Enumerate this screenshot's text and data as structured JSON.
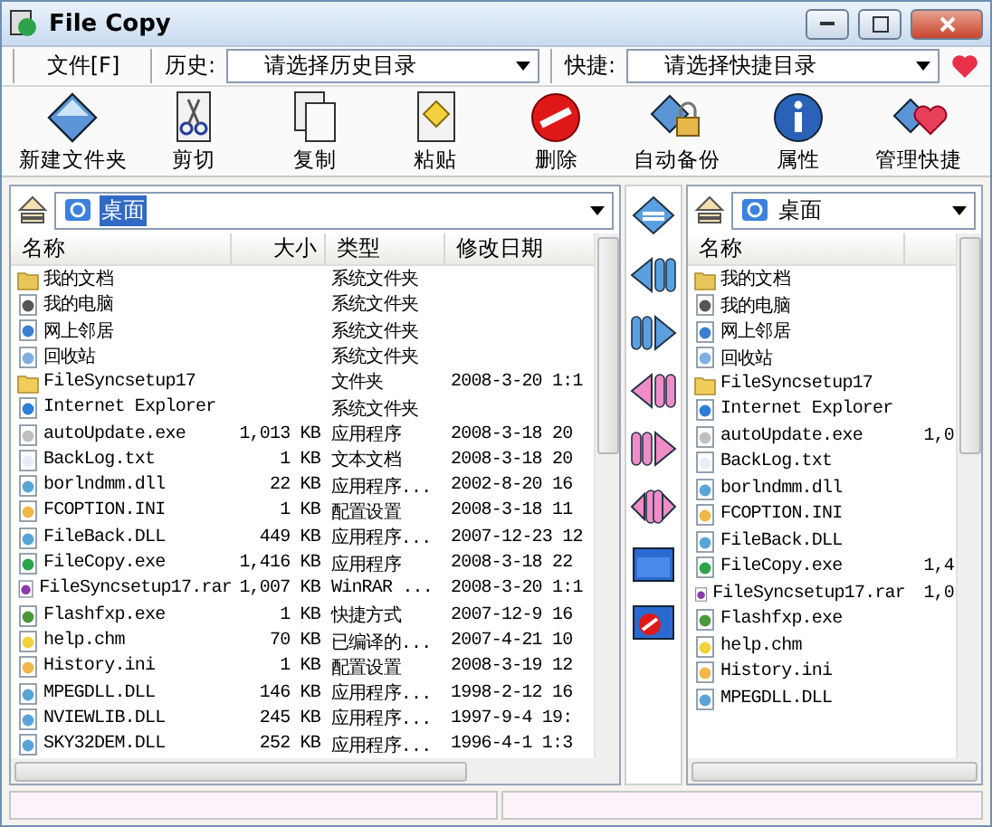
{
  "window": {
    "title": "File Copy"
  },
  "menu": {
    "file": "文件[F]",
    "history_label": "历史:",
    "history_placeholder": "请选择历史目录",
    "shortcut_label": "快捷:",
    "shortcut_placeholder": "请选择快捷目录"
  },
  "toolbar": [
    {
      "label": "新建文件夹",
      "kind": "newfolder"
    },
    {
      "label": "剪切",
      "kind": "cut"
    },
    {
      "label": "复制",
      "kind": "copy"
    },
    {
      "label": "粘贴",
      "kind": "paste"
    },
    {
      "label": "删除",
      "kind": "delete"
    },
    {
      "label": "自动备份",
      "kind": "backup"
    },
    {
      "label": "属性",
      "kind": "info"
    },
    {
      "label": "管理快捷",
      "kind": "favorite"
    }
  ],
  "left_panel": {
    "path": "桌面",
    "path_selected": true,
    "columns": [
      "名称",
      "大小",
      "类型",
      "修改日期"
    ],
    "rows": [
      {
        "name": "我的文档",
        "size": "",
        "type": "系统文件夹",
        "date": "",
        "kind": "docs"
      },
      {
        "name": "我的电脑",
        "size": "",
        "type": "系统文件夹",
        "date": "",
        "kind": "computer"
      },
      {
        "name": "网上邻居",
        "size": "",
        "type": "系统文件夹",
        "date": "",
        "kind": "network"
      },
      {
        "name": "回收站",
        "size": "",
        "type": "系统文件夹",
        "date": "",
        "kind": "recycle"
      },
      {
        "name": "FileSyncsetup17",
        "size": "",
        "type": "文件夹",
        "date": "2008-3-20 1:1",
        "kind": "folder"
      },
      {
        "name": "Internet Explorer",
        "size": "",
        "type": "系统文件夹",
        "date": "",
        "kind": "ie"
      },
      {
        "name": "autoUpdate.exe",
        "size": "1,013 KB",
        "type": "应用程序",
        "date": "2008-3-18 20",
        "kind": "exe"
      },
      {
        "name": "BackLog.txt",
        "size": "1 KB",
        "type": "文本文档",
        "date": "2008-3-18 20",
        "kind": "txt"
      },
      {
        "name": "borlndmm.dll",
        "size": "22 KB",
        "type": "应用程序...",
        "date": "2002-8-20 16",
        "kind": "dll"
      },
      {
        "name": "FCOPTION.INI",
        "size": "1 KB",
        "type": "配置设置",
        "date": "2008-3-18 11",
        "kind": "ini"
      },
      {
        "name": "FileBack.DLL",
        "size": "449 KB",
        "type": "应用程序...",
        "date": "2007-12-23 12",
        "kind": "dll"
      },
      {
        "name": "FileCopy.exe",
        "size": "1,416 KB",
        "type": "应用程序",
        "date": "2008-3-18 22",
        "kind": "app"
      },
      {
        "name": "FileSyncsetup17.rar",
        "size": "1,007 KB",
        "type": "WinRAR ...",
        "date": "2008-3-20 1:1",
        "kind": "rar"
      },
      {
        "name": "Flashfxp.exe",
        "size": "1 KB",
        "type": "快捷方式",
        "date": "2007-12-9 16",
        "kind": "shortcut"
      },
      {
        "name": "help.chm",
        "size": "70 KB",
        "type": "已编译的...",
        "date": "2007-4-21 10",
        "kind": "help"
      },
      {
        "name": "History.ini",
        "size": "1 KB",
        "type": "配置设置",
        "date": "2008-3-19 12",
        "kind": "ini"
      },
      {
        "name": "MPEGDLL.DLL",
        "size": "146 KB",
        "type": "应用程序...",
        "date": "1998-2-12 16",
        "kind": "dll"
      },
      {
        "name": "NVIEWLIB.DLL",
        "size": "245 KB",
        "type": "应用程序...",
        "date": "1997-9-4 19:",
        "kind": "dll"
      },
      {
        "name": "SKY32DEM.DLL",
        "size": "252 KB",
        "type": "应用程序...",
        "date": "1996-4-1 1:3",
        "kind": "dll"
      }
    ]
  },
  "right_panel": {
    "path": "桌面",
    "path_selected": false,
    "columns": [
      "名称"
    ],
    "rows": [
      {
        "name": "我的文档",
        "size": "",
        "kind": "docs"
      },
      {
        "name": "我的电脑",
        "size": "",
        "kind": "computer"
      },
      {
        "name": "网上邻居",
        "size": "",
        "kind": "network"
      },
      {
        "name": "回收站",
        "size": "",
        "kind": "recycle"
      },
      {
        "name": "FileSyncsetup17",
        "size": "",
        "kind": "folder"
      },
      {
        "name": "Internet Explorer",
        "size": "",
        "kind": "ie"
      },
      {
        "name": "autoUpdate.exe",
        "size": "1,0",
        "kind": "exe"
      },
      {
        "name": "BackLog.txt",
        "size": "",
        "kind": "txt"
      },
      {
        "name": "borlndmm.dll",
        "size": "",
        "kind": "dll"
      },
      {
        "name": "FCOPTION.INI",
        "size": "",
        "kind": "ini"
      },
      {
        "name": "FileBack.DLL",
        "size": "",
        "kind": "dll"
      },
      {
        "name": "FileCopy.exe",
        "size": "1,4",
        "kind": "app"
      },
      {
        "name": "FileSyncsetup17.rar",
        "size": "1,0",
        "kind": "rar"
      },
      {
        "name": "Flashfxp.exe",
        "size": "",
        "kind": "shortcut"
      },
      {
        "name": "help.chm",
        "size": "",
        "kind": "help"
      },
      {
        "name": "History.ini",
        "size": "",
        "kind": "ini"
      },
      {
        "name": "MPEGDLL.DLL",
        "size": "",
        "kind": "dll"
      }
    ]
  },
  "middle_buttons": [
    {
      "kind": "swap"
    },
    {
      "kind": "left-blue"
    },
    {
      "kind": "right-blue"
    },
    {
      "kind": "left-pink"
    },
    {
      "kind": "right-pink"
    },
    {
      "kind": "both-pink"
    },
    {
      "kind": "window"
    },
    {
      "kind": "window-stop"
    }
  ]
}
